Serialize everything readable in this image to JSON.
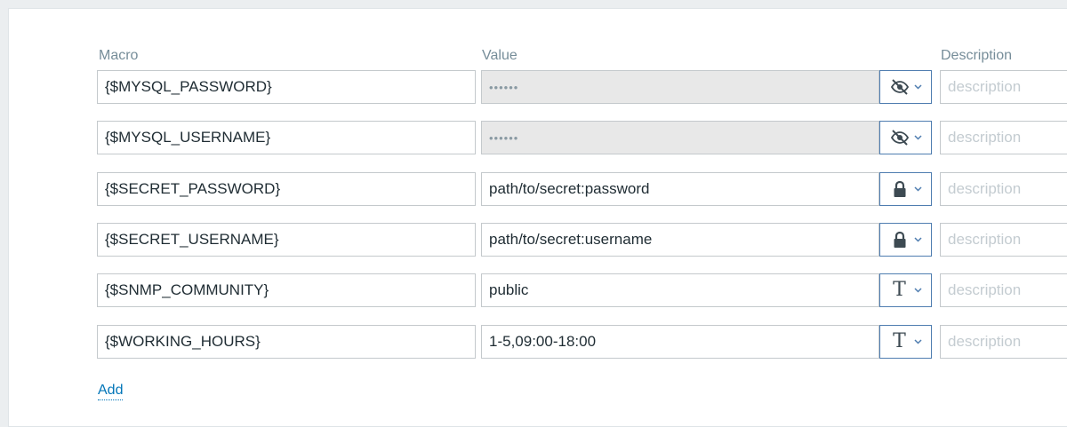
{
  "headers": {
    "macro": "Macro",
    "value": "Value",
    "description": "Description"
  },
  "macros": [
    {
      "macro": "{$MYSQL_PASSWORD}",
      "value": "••••••",
      "type_icon": "eye-slash-icon",
      "description_placeholder": "description"
    },
    {
      "macro": "{$MYSQL_USERNAME}",
      "value": "••••••",
      "type_icon": "eye-slash-icon",
      "description_placeholder": "description"
    },
    {
      "macro": "{$SECRET_PASSWORD}",
      "value": "path/to/secret:password",
      "type_icon": "lock-icon",
      "description_placeholder": "description"
    },
    {
      "macro": "{$SECRET_USERNAME}",
      "value": "path/to/secret:username",
      "type_icon": "lock-icon",
      "description_placeholder": "description"
    },
    {
      "macro": "{$SNMP_COMMUNITY}",
      "value": "public",
      "type_icon": "text-type-icon",
      "description_placeholder": "description"
    },
    {
      "macro": "{$WORKING_HOURS}",
      "value": "1-5,09:00-18:00",
      "type_icon": "text-type-icon",
      "description_placeholder": "description"
    }
  ],
  "add_label": "Add",
  "colors": {
    "link": "#0275b8",
    "button_border": "#4f7db0",
    "secret_bg": "#e8e8e8"
  }
}
